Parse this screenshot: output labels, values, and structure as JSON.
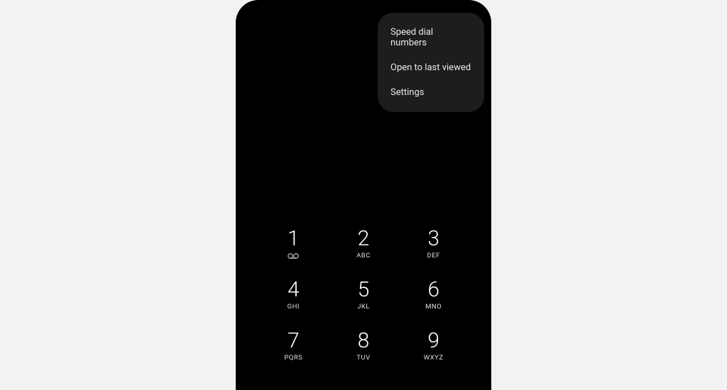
{
  "menu": {
    "items": [
      {
        "label": "Speed dial numbers"
      },
      {
        "label": "Open to last viewed"
      },
      {
        "label": "Settings"
      }
    ]
  },
  "keypad": {
    "keys": [
      {
        "digit": "1",
        "letters": ""
      },
      {
        "digit": "2",
        "letters": "ABC"
      },
      {
        "digit": "3",
        "letters": "DEF"
      },
      {
        "digit": "4",
        "letters": "GHI"
      },
      {
        "digit": "5",
        "letters": "JKL"
      },
      {
        "digit": "6",
        "letters": "MNO"
      },
      {
        "digit": "7",
        "letters": "PQRS"
      },
      {
        "digit": "8",
        "letters": "TUV"
      },
      {
        "digit": "9",
        "letters": "WXYZ"
      }
    ]
  }
}
